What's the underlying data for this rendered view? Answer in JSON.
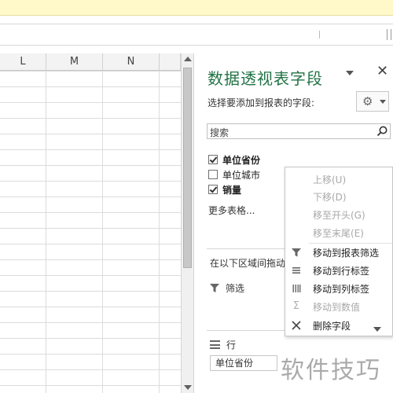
{
  "grid": {
    "columns": [
      "L",
      "M",
      "N"
    ]
  },
  "pivot_pane": {
    "title": "数据透视表字段",
    "subtitle": "选择要添加到报表的字段:",
    "search_placeholder": "搜索",
    "fields": [
      {
        "label": "单位省份",
        "checked": true
      },
      {
        "label": "单位城市",
        "checked": false
      },
      {
        "label": "销量",
        "checked": true
      }
    ],
    "more_tables": "更多表格...",
    "drag_hint": "在以下区域间拖动字段",
    "filter_area_label": "筛选",
    "rows_area_label": "行",
    "row_field": "单位省份"
  },
  "context_menu": {
    "items": [
      {
        "label": "上移(U)",
        "enabled": false,
        "icon": "none"
      },
      {
        "label": "下移(D)",
        "enabled": false,
        "icon": "none"
      },
      {
        "label": "移至开头(G)",
        "enabled": false,
        "icon": "none"
      },
      {
        "label": "移至末尾(E)",
        "enabled": false,
        "icon": "none"
      },
      {
        "label": "移动到报表筛选",
        "enabled": true,
        "icon": "filter-icon"
      },
      {
        "label": "移动到行标签",
        "enabled": true,
        "icon": "rows-icon"
      },
      {
        "label": "移动到列标签",
        "enabled": true,
        "icon": "columns-icon"
      },
      {
        "label": "移动到数值",
        "enabled": false,
        "icon": "sigma-icon"
      },
      {
        "label": "删除字段",
        "enabled": true,
        "icon": "x-icon"
      }
    ]
  },
  "watermark": "软件技巧",
  "colors": {
    "title_green": "#217346",
    "notification_yellow": "#fff9c9",
    "disabled_text": "#a8a8a8"
  }
}
